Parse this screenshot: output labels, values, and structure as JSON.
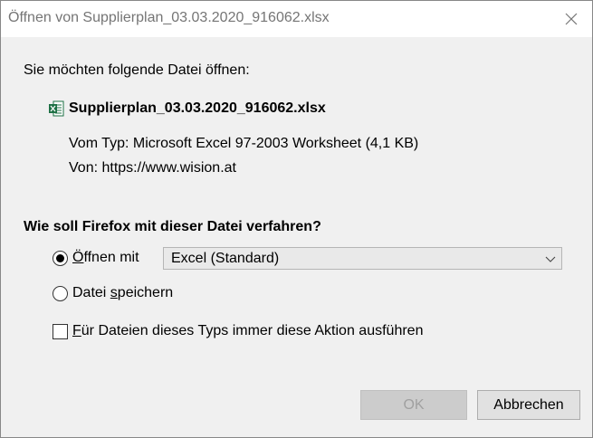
{
  "window": {
    "title": "Öffnen von Supplierplan_03.03.2020_916062.xlsx"
  },
  "intro": "Sie möchten folgende Datei öffnen:",
  "file": {
    "name": "Supplierplan_03.03.2020_916062.xlsx",
    "type_label": "Vom Typ:",
    "type_value": "Microsoft Excel 97-2003 Worksheet (4,1 KB)",
    "from_label": "Von:",
    "from_value": "https://www.wision.at",
    "icon": "excel-file-icon"
  },
  "question": "Wie soll Firefox mit dieser Datei verfahren?",
  "options": {
    "open_with": {
      "label_first": "Ö",
      "label_rest": "ffnen mit",
      "selected": true,
      "app": "Excel (Standard)"
    },
    "save": {
      "label_before": "Datei ",
      "label_accel": "s",
      "label_after": "peichern",
      "selected": false
    },
    "always": {
      "label_first": "F",
      "label_rest": "ür Dateien dieses Typs immer diese Aktion ausführen",
      "checked": false
    }
  },
  "buttons": {
    "ok": "OK",
    "cancel": "Abbrechen"
  },
  "colors": {
    "dialog_bg": "#f0f0f0",
    "title_text": "#757575",
    "excel_green": "#1d7044"
  }
}
